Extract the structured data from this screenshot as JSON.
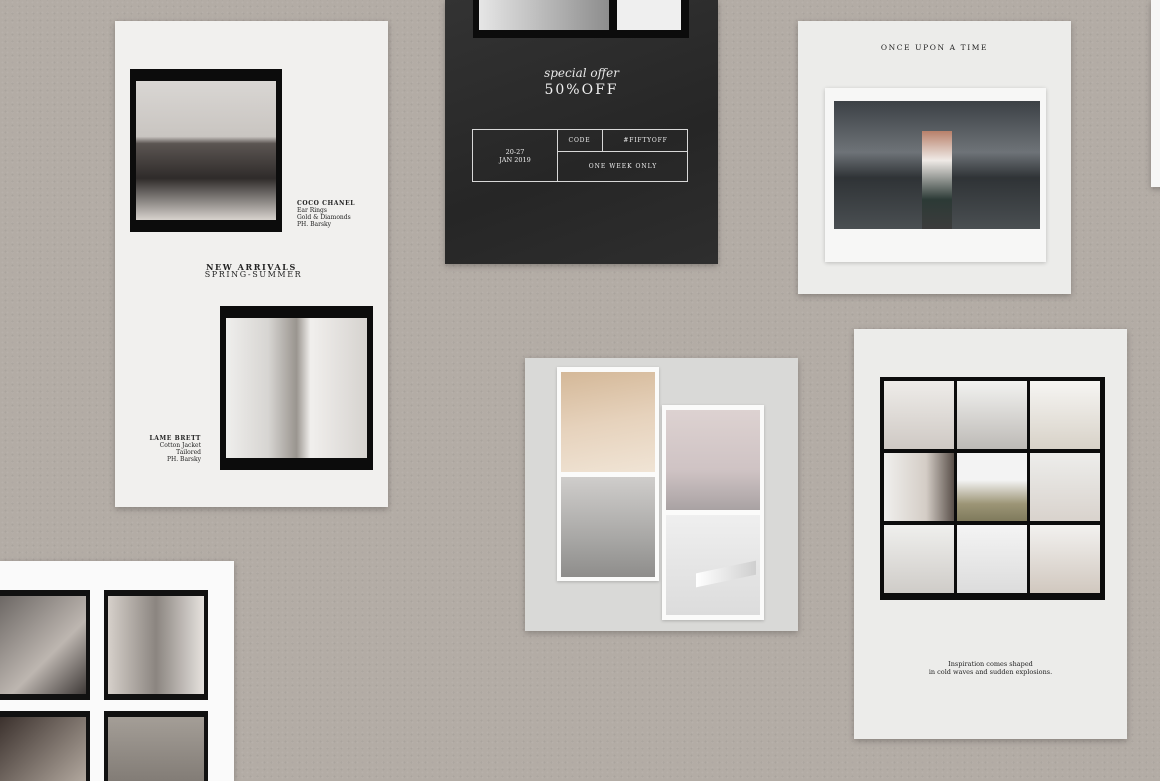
{
  "card_story": {
    "caption_1": [
      "COCO CHANEL",
      "Ear Rings",
      "Gold & Diamonds",
      "PH. Barsky"
    ],
    "title": "NEW ARRIVALS",
    "subtitle": "SPRING-SUMMER",
    "caption_2": [
      "LAME BRETT",
      "Cotton Jacket",
      "Tailored",
      "PH. Barsky"
    ]
  },
  "card_offer": {
    "script": "special offer",
    "headline": "50%OFF",
    "dates": "20-27",
    "month": "JAN 2019",
    "code_label": "CODE",
    "code_value": "#FIFTYOFF",
    "duration": "ONE WEEK ONLY"
  },
  "card_polaroid": {
    "title": "ONCE UPON A TIME"
  },
  "card_grid": {
    "line_1": "Inspiration comes shaped",
    "line_2": "in cold waves and sudden explosions."
  },
  "colors": {
    "background": "#b3aca5",
    "card": "#ececea",
    "dark_card": "#2a2a2a",
    "film": "#0c0c0c"
  }
}
